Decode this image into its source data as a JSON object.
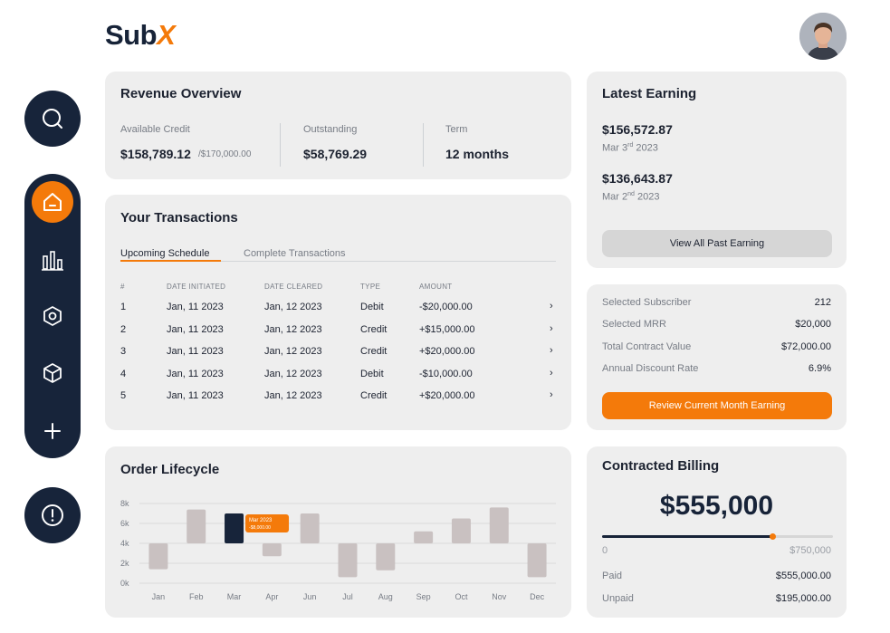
{
  "brand": {
    "name_main": "Sub",
    "name_accent": "X"
  },
  "revenue": {
    "title": "Revenue Overview",
    "available_credit_label": "Available Credit",
    "available_credit_value": "$158,789.12",
    "available_credit_limit": "/$170,000.00",
    "outstanding_label": "Outstanding",
    "outstanding_value": "$58,769.29",
    "term_label": "Term",
    "term_value": "12 months"
  },
  "transactions": {
    "title": "Your Transactions",
    "tabs": [
      {
        "label": "Upcoming Schedule",
        "active": true
      },
      {
        "label": "Complete Transactions",
        "active": false
      }
    ],
    "headers": [
      "#",
      "DATE INITIATED",
      "DATE CLEARED",
      "TYPE",
      "AMOUNT"
    ],
    "rows": [
      {
        "num": "1",
        "initiated": "Jan, 11 2023",
        "cleared": "Jan, 12 2023",
        "type": "Debit",
        "amount": "-$20,000.00"
      },
      {
        "num": "2",
        "initiated": "Jan, 11 2023",
        "cleared": "Jan, 12 2023",
        "type": "Credit",
        "amount": "+$15,000.00"
      },
      {
        "num": "3",
        "initiated": "Jan, 11 2023",
        "cleared": "Jan, 12 2023",
        "type": "Credit",
        "amount": "+$20,000.00"
      },
      {
        "num": "4",
        "initiated": "Jan, 11 2023",
        "cleared": "Jan, 12 2023",
        "type": "Debit",
        "amount": "-$10,000.00"
      },
      {
        "num": "5",
        "initiated": "Jan, 11 2023",
        "cleared": "Jan, 12 2023",
        "type": "Credit",
        "amount": "+$20,000.00"
      }
    ],
    "chevron": "›"
  },
  "latest": {
    "title": "Latest Earning",
    "items": [
      {
        "amount": "$156,572.87",
        "date_pre": "Mar 3",
        "date_sup": "rd",
        "date_post": " 2023"
      },
      {
        "amount": "$136,643.87",
        "date_pre": "Mar 2",
        "date_sup": "nd",
        "date_post": " 2023"
      }
    ],
    "button": "View All Past Earning"
  },
  "summary": {
    "rows": [
      {
        "label": "Selected Subscriber",
        "value": "212"
      },
      {
        "label": "Selected MRR",
        "value": "$20,000"
      },
      {
        "label": "Total Contract Value",
        "value": "$72,000.00"
      },
      {
        "label": "Annual Discount Rate",
        "value": "6.9%"
      }
    ],
    "button": "Review Current Month Earning"
  },
  "billing": {
    "title": "Contracted Billing",
    "amount": "$555,000",
    "range_min": "0",
    "range_max": "$750,000",
    "progress": 0.74,
    "paid_label": "Paid",
    "paid_value": "$555,000.00",
    "unpaid_label": "Unpaid",
    "unpaid_value": "$195,000.00"
  },
  "order": {
    "title": "Order Lifecycle"
  },
  "icons": {
    "search": "search-icon",
    "home": "home-icon",
    "chart": "bar-chart-icon",
    "hexagon": "hexagon-icon",
    "box": "box-icon",
    "plus": "plus-icon",
    "alert": "alert-icon"
  },
  "colors": {
    "accent": "#f47a0a",
    "navy": "#17243a",
    "bar": "#c9c1c1"
  },
  "chart_data": {
    "type": "bar",
    "title": "Order Lifecycle",
    "categories": [
      "Jan",
      "Feb",
      "Mar",
      "Apr",
      "Jun",
      "Jul",
      "Aug",
      "Sep",
      "Oct",
      "Nov",
      "Dec"
    ],
    "bars": [
      {
        "low": 1.4,
        "high": 4.0
      },
      {
        "low": 4.0,
        "high": 7.4
      },
      {
        "low": 4.0,
        "high": 7.0
      },
      {
        "low": 2.7,
        "high": 4.0
      },
      {
        "low": 4.0,
        "high": 7.0
      },
      {
        "low": 0.6,
        "high": 4.0
      },
      {
        "low": 1.3,
        "high": 4.0
      },
      {
        "low": 4.0,
        "high": 5.2
      },
      {
        "low": 4.0,
        "high": 6.5
      },
      {
        "low": 4.0,
        "high": 7.6
      },
      {
        "low": 0.6,
        "high": 4.0
      }
    ],
    "highlight_index": 2,
    "tooltip": {
      "title": "Mar 2023",
      "value": "-$8,000.00"
    },
    "y_ticks": [
      "8k",
      "6k",
      "4k",
      "2k",
      "0k"
    ],
    "ylim": [
      0,
      8
    ],
    "grid": true
  }
}
